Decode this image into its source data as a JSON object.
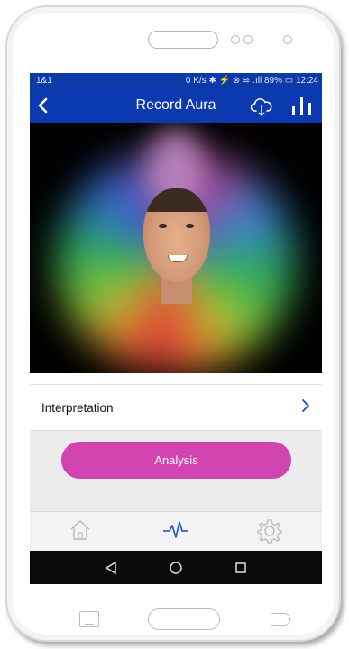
{
  "status_bar": {
    "carrier": "1&1",
    "right_text": "0 K/s ✱ ⚡ ⊗ ≋ .ıll 89% ▭ 12:24"
  },
  "app_bar": {
    "title": "Record Aura",
    "back_icon": "chevron-left-icon",
    "cloud_icon": "cloud-download-icon",
    "chart_icon": "bar-chart-icon"
  },
  "content": {
    "interpretation_label": "Interpretation",
    "analysis_button_label": "Analysis"
  },
  "colors": {
    "app_bar": "#0b39b0",
    "accent_button": "#d244b0",
    "active_tab": "#1a4fd0"
  },
  "tab_bar": {
    "tabs": [
      {
        "icon": "home-icon",
        "active": false
      },
      {
        "icon": "heartbeat-icon",
        "active": true
      },
      {
        "icon": "settings-gear-icon",
        "active": false
      }
    ]
  },
  "system_nav": {
    "buttons": [
      "back-triangle-icon",
      "home-circle-icon",
      "recents-square-icon"
    ]
  }
}
